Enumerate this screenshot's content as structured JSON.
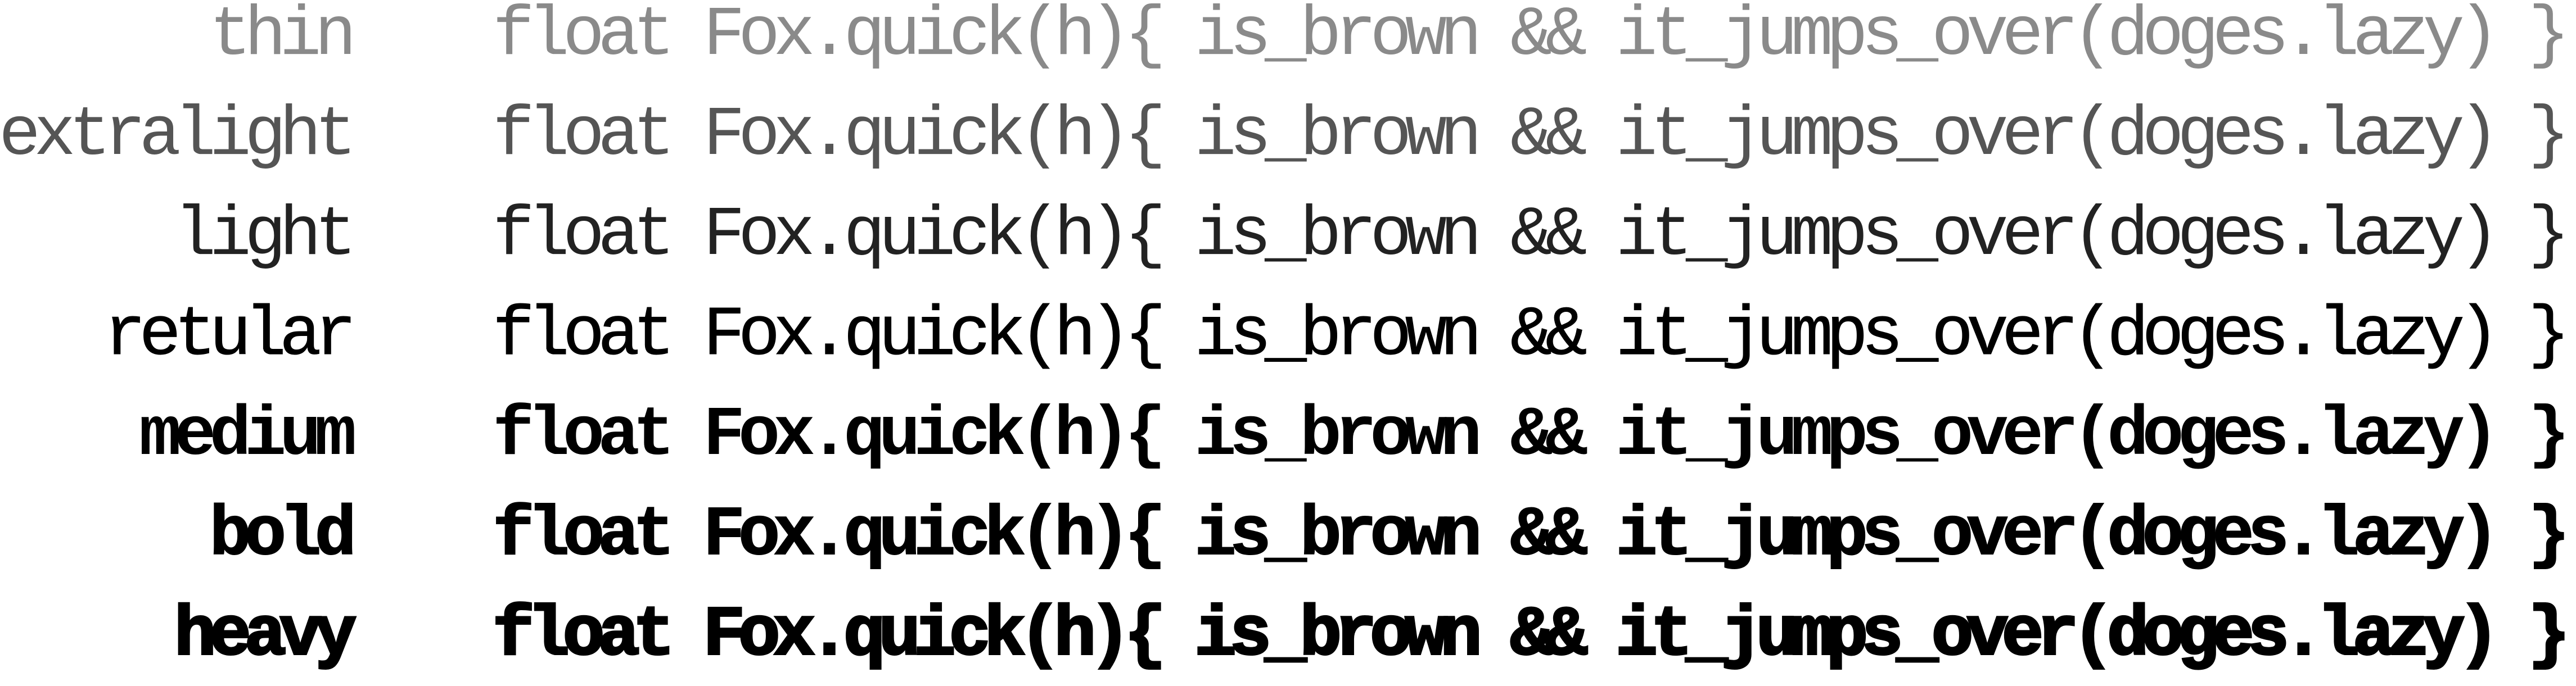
{
  "specimen": {
    "sample": "float Fox.quick(h){ is_brown && it_jumps_over(doges.lazy) }",
    "rows": [
      {
        "label": "thin",
        "weight": "thin"
      },
      {
        "label": "extralight",
        "weight": "extralight"
      },
      {
        "label": "light",
        "weight": "light"
      },
      {
        "label": "retular",
        "weight": "regular"
      },
      {
        "label": "medium",
        "weight": "medium"
      },
      {
        "label": "bold",
        "weight": "bold"
      },
      {
        "label": "heavy",
        "weight": "heavy"
      }
    ]
  }
}
